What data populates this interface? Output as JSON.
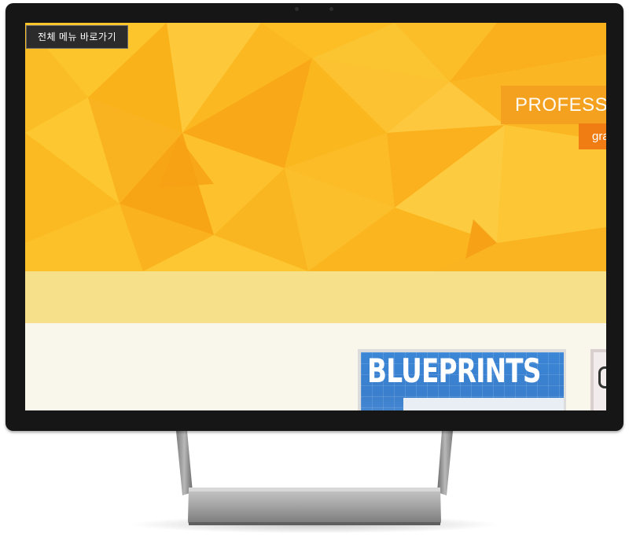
{
  "accessibility": {
    "skip_link_label": "전체 메뉴 바로가기"
  },
  "hero": {
    "title": "PROFESSIO",
    "subtitle": "gra",
    "colors": {
      "base": "#fbbb1e",
      "title_box": "#f4a020",
      "subtitle_box": "#ef7d14",
      "band": "#f6e18a"
    }
  },
  "content": {
    "featured_card": {
      "title": "BLUEPRINTS"
    }
  },
  "device": {
    "type": "all-in-one desktop monitor",
    "frame_color": "#161616"
  }
}
